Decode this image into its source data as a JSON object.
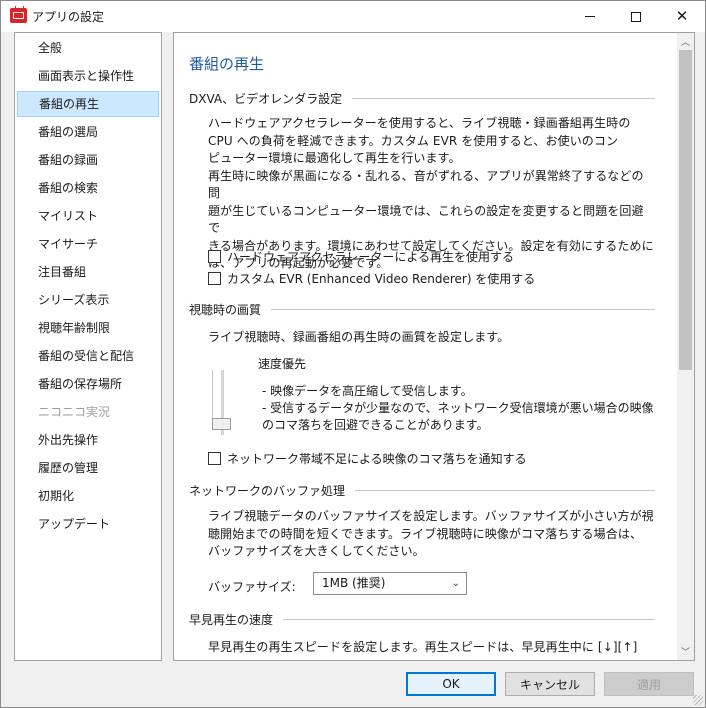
{
  "window": {
    "title": "アプリの設定",
    "minimize_glyph": "",
    "close_glyph": "✕"
  },
  "sidebar": {
    "items": [
      {
        "label": "全般"
      },
      {
        "label": "画面表示と操作性"
      },
      {
        "label": "番組の再生",
        "selected": true
      },
      {
        "label": "番組の選局"
      },
      {
        "label": "番組の録画"
      },
      {
        "label": "番組の検索"
      },
      {
        "label": "マイリスト"
      },
      {
        "label": "マイサーチ"
      },
      {
        "label": "注目番組"
      },
      {
        "label": "シリーズ表示"
      },
      {
        "label": "視聴年齢制限"
      },
      {
        "label": "番組の受信と配信"
      },
      {
        "label": "番組の保存場所"
      },
      {
        "label": "ニコニコ実況",
        "disabled": true
      },
      {
        "label": "外出先操作"
      },
      {
        "label": "履歴の管理"
      },
      {
        "label": "初期化"
      },
      {
        "label": "アップデート"
      }
    ]
  },
  "main": {
    "page_title": "番組の再生",
    "dxva": {
      "heading": "DXVA、ビデオレンダラ設定",
      "lines": [
        "ハードウェアアクセラレーターを使用すると、ライブ視聴・録画番組再生時の",
        "CPU への負荷を軽減できます。カスタム EVR を使用すると、お使いのコン",
        "ピューター環境に最適化して再生を行います。",
        "再生時に映像が黒画になる・乱れる、音がずれる、アプリが異常終了するなどの問",
        "題が生じているコンピューター環境では、これらの設定を変更すると問題を回避で",
        "きる場合があります。環境にあわせて設定してください。設定を有効にするために",
        "は、アプリの再起動が必要です。"
      ],
      "check_hw": "ハードウェアアクセラレーターによる再生を使用する",
      "check_evr": "カスタム EVR (Enhanced Video Renderer) を使用する"
    },
    "quality": {
      "heading": "視聴時の画質",
      "desc": "ライブ視聴時、録画番組の再生時の画質を設定します。",
      "slider_label": "速度優先",
      "bullet1": "-  映像データを高圧縮して受信します。",
      "bullet2": "-  受信するデータが少量なので、ネットワーク受信環境が悪い場合の映像",
      "bullet2b": "   のコマ落ちを回避できることがあります。",
      "check_notify": "ネットワーク帯域不足による映像のコマ落ちを通知する"
    },
    "buffer": {
      "heading": "ネットワークのバッファ処理",
      "lines": [
        "ライブ視聴データのバッファサイズを設定します。バッファサイズが小さい方が視",
        "聴開始までの時間を短くできます。ライブ視聴時に映像がコマ落ちする場合は、",
        "バッファサイズを大きくしてください。"
      ],
      "size_label": "バッファサイズ:",
      "size_value": "1MB (推奨)"
    },
    "fast": {
      "heading": "早見再生の速度",
      "line1": "早見再生の再生スピードを設定します。再生スピードは、早見再生中に [↓][↑]"
    }
  },
  "buttons": {
    "ok": "OK",
    "cancel": "キャンセル",
    "apply": "適用"
  },
  "colors": {
    "accent": "#1f5aa8",
    "selected_bg": "#cce8ff",
    "ok_border": "#0078d7"
  }
}
